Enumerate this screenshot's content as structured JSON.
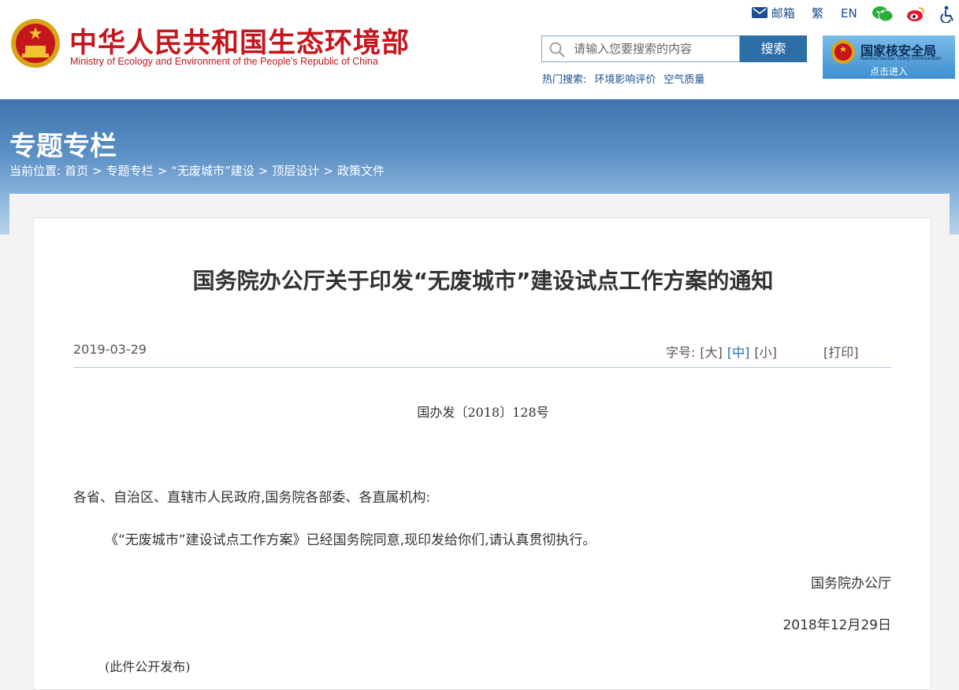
{
  "header": {
    "site_name_cn": "中华人民共和国生态环境部",
    "site_name_en": "Ministry of Ecology and Environment of the People's Republic of China",
    "topbar": {
      "mail": "邮箱",
      "traditional": "繁",
      "english": "EN"
    },
    "search": {
      "placeholder": "请输入您要搜索的内容",
      "button": "搜索"
    },
    "hot_search": {
      "label": "热门搜索:",
      "items": [
        "环境影响评价",
        "空气质量"
      ]
    },
    "nsa": {
      "title": "国家核安全局",
      "subtitle": "National Nuclear Safety Administration",
      "enter": "点击进入"
    }
  },
  "banner": {
    "title": "专题专栏",
    "breadcrumb": [
      "当前位置:",
      "首页",
      ">",
      "专题专栏",
      ">",
      "“无废城市”建设",
      ">",
      "顶层设计",
      ">",
      "政策文件"
    ]
  },
  "article": {
    "title": "国务院办公厅关于印发“无废城市”建设试点工作方案的通知",
    "date": "2019-03-29",
    "font_size_label": "字号:",
    "font_sizes": [
      "[大]",
      "[中]",
      "[小]"
    ],
    "print": "[打印]",
    "doc_number": "国办发〔2018〕128号",
    "salutation": "各省、自治区、直辖市人民政府,国务院各部委、各直属机构:",
    "body": "《“无废城市”建设试点工作方案》已经国务院同意,现印发给你们,请认真贯彻执行。",
    "signer": "国务院办公厅",
    "sign_date": "2018年12月29日",
    "note": "(此件公开发布)"
  },
  "colors": {
    "brand_red": "#c4161c",
    "link_blue": "#1b4f8c",
    "button_blue": "#2d6ea7"
  },
  "icons": [
    "emblem-icon",
    "mail-icon",
    "wechat-icon",
    "weibo-icon",
    "accessibility-icon",
    "search-icon",
    "nsa-emblem-icon"
  ]
}
